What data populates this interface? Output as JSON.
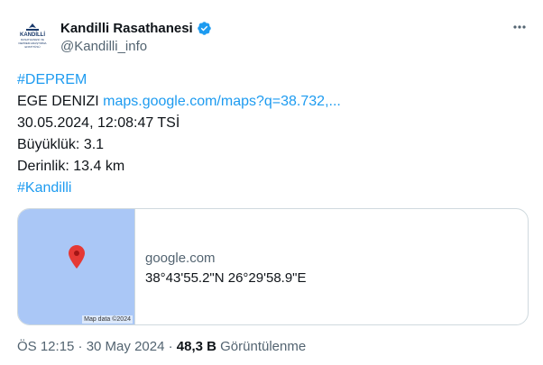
{
  "author": {
    "display_name": "Kandilli Rasathanesi",
    "handle": "@Kandilli_info",
    "avatar_lines": [
      "KANDİLLİ",
      "RASATHANESİ VE",
      "DEPREM ARAŞTIRMA",
      "ENSTİTÜSÜ"
    ],
    "verified": true
  },
  "more_icon": "more-horizontal-icon",
  "tweet": {
    "hashtag_deprem": "#DEPREM",
    "location": "EGE DENIZI ",
    "map_link": "maps.google.com/maps?q=38.732,...",
    "datetime": "30.05.2024, 12:08:47 TSİ",
    "magnitude": "Büyüklük: 3.1",
    "depth": "Derinlik: 13.4 km",
    "hashtag_kandilli": "#Kandilli"
  },
  "card": {
    "map_credit": "Map data ©2024",
    "domain": "google.com",
    "title": "38°43'55.2\"N 26°29'58.9\"E"
  },
  "meta": {
    "time_date": "ÖS 12:15 · 30 May 2024 · ",
    "views_count": "48,3 B",
    "views_label": " Görüntülenme"
  },
  "colors": {
    "link": "#1d9bf0",
    "map_water": "#aac7f6",
    "pin": "#e53935"
  }
}
